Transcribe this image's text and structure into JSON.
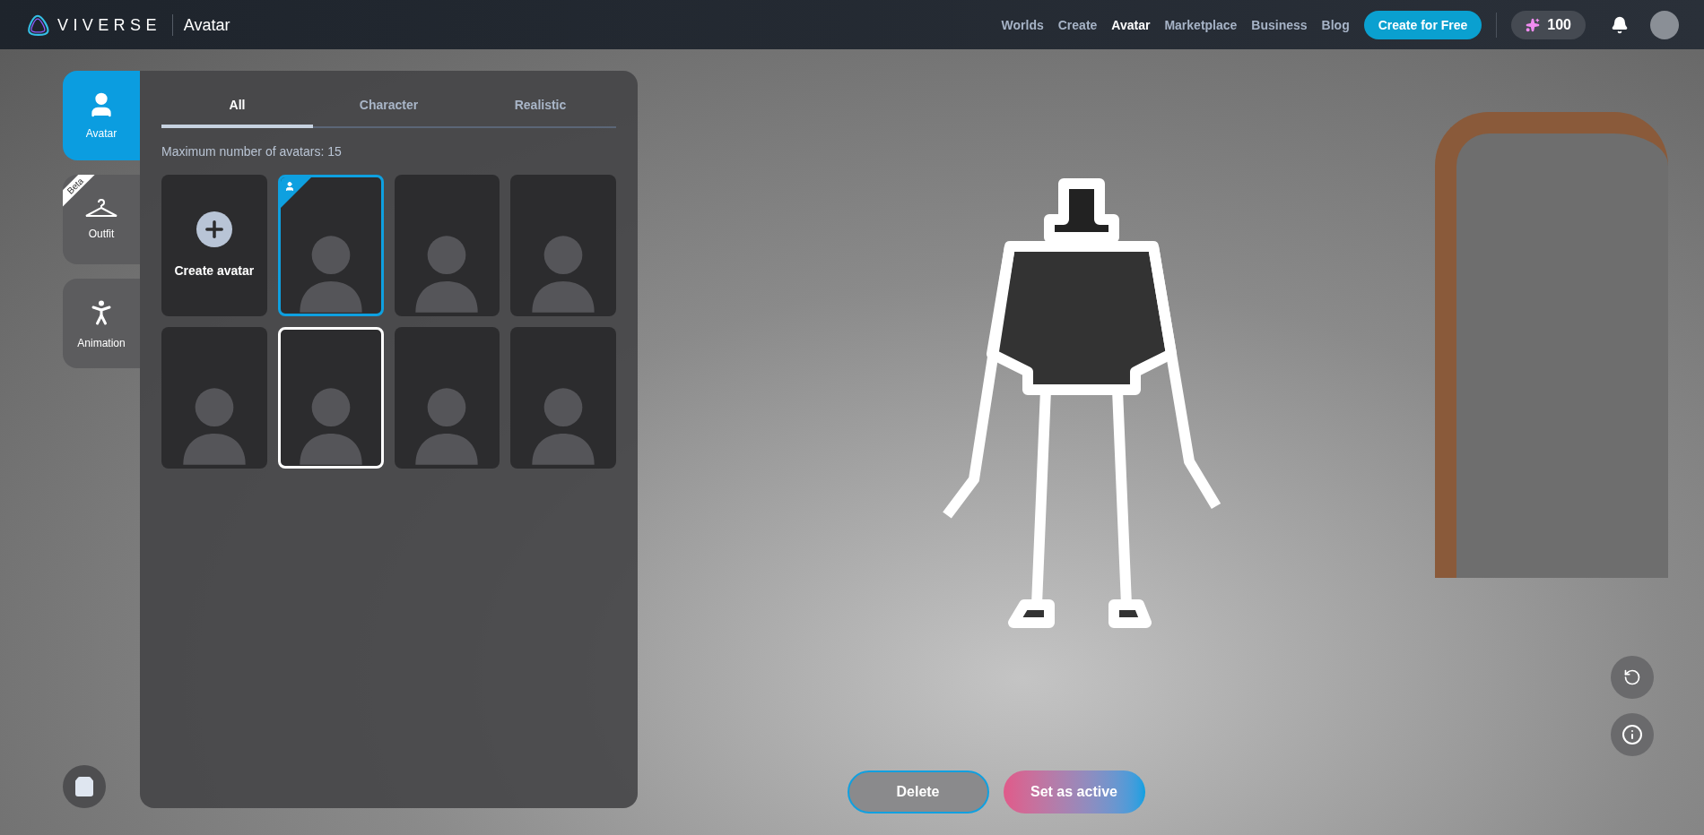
{
  "nav": {
    "brand": "VIVERSE",
    "section": "Avatar",
    "links": [
      {
        "label": "Worlds",
        "selected": false
      },
      {
        "label": "Create",
        "selected": false
      },
      {
        "label": "Avatar",
        "selected": true
      },
      {
        "label": "Marketplace",
        "selected": false
      },
      {
        "label": "Business",
        "selected": false
      },
      {
        "label": "Blog",
        "selected": false
      }
    ],
    "cta": "Create for Free",
    "credits": "100"
  },
  "side_tabs": [
    {
      "label": "Avatar",
      "selected": true,
      "kind": "avatar"
    },
    {
      "label": "Outfit",
      "selected": false,
      "kind": "outfit",
      "badge": "Beta"
    },
    {
      "label": "Animation",
      "selected": false,
      "kind": "animation"
    }
  ],
  "panel": {
    "tabs": [
      {
        "label": "All",
        "selected": true
      },
      {
        "label": "Character",
        "selected": false
      },
      {
        "label": "Realistic",
        "selected": false
      }
    ],
    "info": "Maximum number of avatars: 15",
    "tiles": [
      {
        "kind": "create",
        "label": "Create avatar"
      },
      {
        "kind": "avatar",
        "active": true,
        "selected": false
      },
      {
        "kind": "avatar",
        "active": false,
        "selected": false
      },
      {
        "kind": "avatar",
        "active": false,
        "selected": false
      },
      {
        "kind": "avatar",
        "active": false,
        "selected": false
      },
      {
        "kind": "avatar",
        "active": false,
        "selected": true
      },
      {
        "kind": "avatar",
        "active": false,
        "selected": false
      },
      {
        "kind": "avatar",
        "active": false,
        "selected": false
      }
    ]
  },
  "actions": [
    "Delete",
    "Set as active"
  ]
}
